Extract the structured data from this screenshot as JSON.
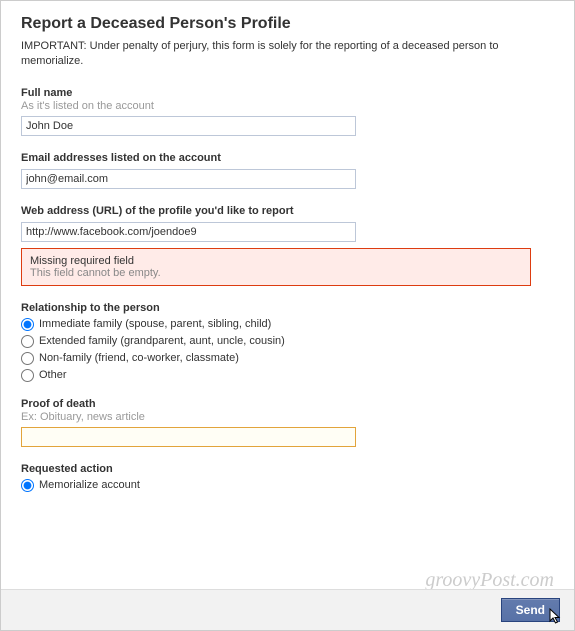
{
  "header": {
    "title": "Report a Deceased Person's Profile",
    "important": "IMPORTANT: Under penalty of perjury, this form is solely for the reporting of a deceased person to memorialize."
  },
  "fullname": {
    "label": "Full name",
    "hint": "As it's listed on the account",
    "value": "John Doe"
  },
  "email": {
    "label": "Email addresses listed on the account",
    "value": "john@email.com"
  },
  "url": {
    "label": "Web address (URL) of the profile you'd like to report",
    "value": "http://www.facebook.com/joendoe9"
  },
  "error": {
    "title": "Missing required field",
    "text": "This field cannot be empty."
  },
  "relationship": {
    "label": "Relationship to the person",
    "options": [
      "Immediate family (spouse, parent, sibling, child)",
      "Extended family (grandparent, aunt, uncle, cousin)",
      "Non-family (friend, co-worker, classmate)",
      "Other"
    ],
    "selected": 0
  },
  "proof": {
    "label": "Proof of death",
    "hint": "Ex: Obituary, news article",
    "value": ""
  },
  "action": {
    "label": "Requested action",
    "options": [
      "Memorialize account"
    ],
    "selected": 0
  },
  "footer": {
    "send_label": "Send"
  },
  "watermark": "groovyPost.com"
}
